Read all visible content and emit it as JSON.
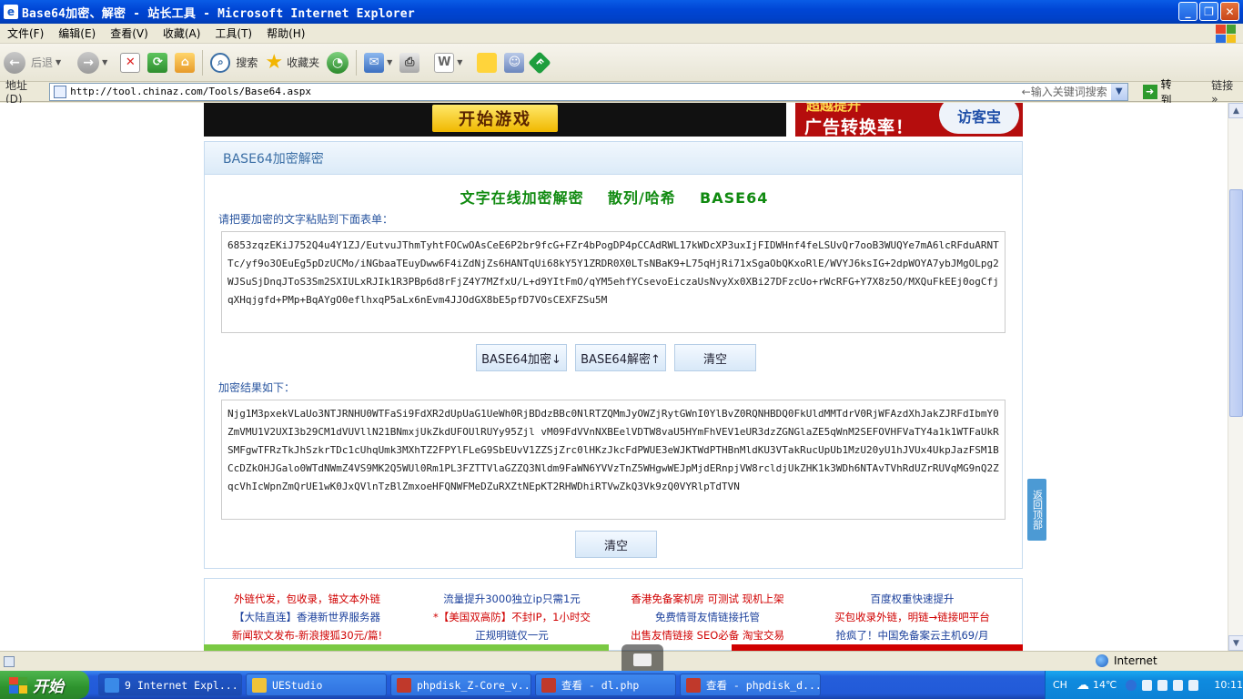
{
  "window": {
    "title": "Base64加密、解密 - 站长工具 - Microsoft Internet Explorer",
    "controls": {
      "minimize": "_",
      "maximize": "❐",
      "close": "✕"
    }
  },
  "menu": [
    "文件(F)",
    "编辑(E)",
    "查看(V)",
    "收藏(A)",
    "工具(T)",
    "帮助(H)"
  ],
  "toolbar": {
    "back_label": "后退",
    "search_label": "搜索",
    "favorites_label": "收藏夹"
  },
  "address": {
    "label": "地址(D)",
    "url": "http://tool.chinaz.com/Tools/Base64.aspx",
    "search_hint": "←输入关键词搜索",
    "go_label": "转到",
    "links_label": "链接"
  },
  "ads": {
    "game_button": "开始游戏",
    "right_headline": "广告转换率！",
    "right_top": "超越提升",
    "right_brand": "访客宝"
  },
  "panel": {
    "header": "BASE64加密解密",
    "heading": "文字在线加密解密    散列/哈希    BASE64",
    "input_prompt": "请把要加密的文字粘贴到下面表单：",
    "input_text": "6853zqzEKiJ752Q4u4Y1ZJ/EutvuJThmTyhtFOCwOAsCeE6P2br9fcG+FZr4bPogDP4pCCAdRWL17kWDcXP3uxIjFIDWHnf4feLSUvQr7ooB3WUQYe7mA6lcRFduARNTTc/yf9o3OEuEg5pDzUCMo/iNGbaaTEuyDww6F4iZdNjZs6HANTqUi68kY5Y1ZRDR0X0LTsNBaK9+L75qHjRi71xSgaObQKxoRlE/WVYJ6ksIG+2dpWOYA7ybJMgOLpg2WJSuSjDnqJToS3Sm2SXIULxRJIk1R3PBp6d8rFjZ4Y7MZfxU/L+d9YItFmO/qYM5ehfYCsevoEiczaUsNvyXx0XBi27DFzcUo+rWcRFG+Y7X8z5O/MXQuFkEEj0ogCfjqXHqjgfd+PMp+BqAYgO0eflhxqP5aLx6nEvm4JJOdGX8bE5pfD7VOsCEXFZSu5M",
    "encode_button": "BASE64加密↓",
    "decode_button": "BASE64解密↑",
    "clear_button": "清空",
    "result_prompt": "加密结果如下：",
    "result_text": "Njg1M3pxekVLaUo3NTJRNHU0WTFaSi9FdXR2dUpUaG1UeWh0RjBDdzBBc0NlRTZQMmJyOWZjRytGWnI0YlBvZ0RQNHBDQ0FkUldMMTdrV0RjWFAzdXhJakZJRFdIbmY0ZmVMU1V2UXI3b29CM1dVUVllN21BNmxjUkZkdUFOUlRUYy95Zjl vM09FdVVnNXBEelVDTW8vaU5HYmFhVEV1eUR3dzZGNGlaZE5qWnM2SEFOVHFVaTY4a1k1WTFaUkRSMFgwTFRzTkJhSzkrTDc1cUhqUmk3MXhTZ2FPYlFLeG9SbEUvV1ZZSjZrc0lHKzJkcFdPWUE3eWJKTWdPTHBnMldKU3VTakRucUpUb1MzU20yU1hJVUx4UkpJazFSM1BCcDZkOHJGalo0WTdNWmZ4VS9MK2Q5WUl0Rm1PL3FZTTVlaGZZQ3Nldm9FaWN6YVVzTnZ5WHgwWEJpMjdERnpjVW8rcldjUkZHK1k3WDh6NTAvTVhRdUZrRUVqMG9nQ2ZqcVhIcWpnZmQrUE1wK0JxQVlnTzBlZmxoeHFQNWFMeDZuRXZtNEpKT2RHWDhiRTVwZkQ3Vk9zQ0VYRlpTdTVN",
    "result_clear_button": "清空"
  },
  "ad_links": [
    {
      "lines": [
        {
          "text": "外链代发，包收录，锚文本外链",
          "color": "red"
        },
        {
          "text": "【大陆直连】香港新世界服务器",
          "color": "blue"
        },
        {
          "text": "新闻软文发布-新浪搜狐30元/篇!",
          "color": "red"
        }
      ]
    },
    {
      "lines": [
        {
          "text": "流量提升3000独立ip只需1元",
          "color": "blue"
        },
        {
          "text": "*【美国双高防】不封IP，1小时交",
          "color": "red"
        },
        {
          "text": "正规明链仅一元",
          "color": "blue"
        }
      ]
    },
    {
      "lines": [
        {
          "text": "香港免备案机房 可测试 现机上架",
          "color": "red"
        },
        {
          "text": "免费情哥友情链接托管",
          "color": "blue"
        },
        {
          "text": "出售友情链接 SEO必备 淘宝交易",
          "color": "red"
        }
      ]
    },
    {
      "lines": [
        {
          "text": "百度权重快速提升",
          "color": "blue"
        },
        {
          "text": "买包收录外链，明链→链接吧平台",
          "color": "red"
        },
        {
          "text": "抢疯了！中国免备案云主机69/月",
          "color": "blue"
        }
      ]
    }
  ],
  "side_tab": "返回顶部",
  "status": {
    "zone": "Internet"
  },
  "taskbar": {
    "start_label": "开始",
    "tasks": [
      {
        "label": "9 Internet Expl...",
        "active": true
      },
      {
        "label": "UEStudio",
        "active": false
      },
      {
        "label": "phpdisk_Z-Core_v...",
        "active": false
      },
      {
        "label": "查看 - dl.php",
        "active": false
      },
      {
        "label": "查看 - phpdisk_d...",
        "active": false
      }
    ],
    "ime": "CH",
    "temperature": "14℃",
    "clock": "10:11"
  },
  "colors": {
    "accent_blue": "#3a6ea5",
    "heading_green": "#108a10",
    "ad_red": "#d00000",
    "ad_blue": "#1a3f9b"
  }
}
